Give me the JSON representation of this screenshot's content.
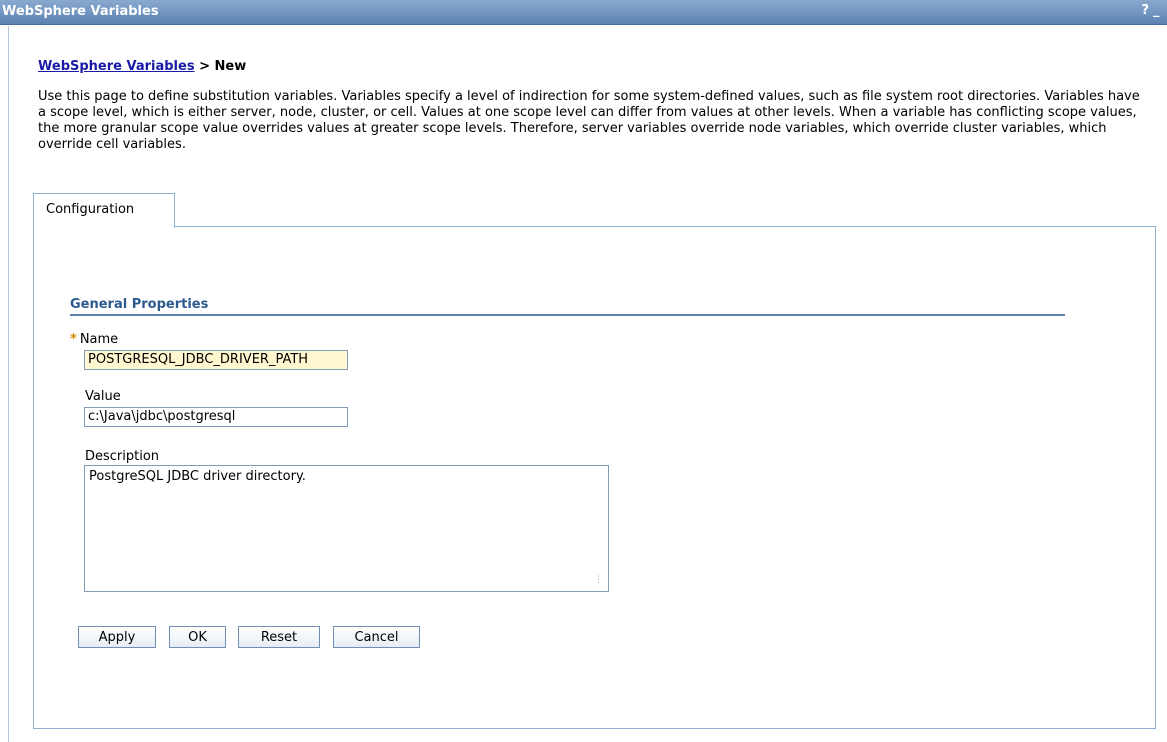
{
  "window": {
    "title": "WebSphere Variables",
    "help_label": "?",
    "minimize_label": "_"
  },
  "breadcrumb": {
    "parent_link": "WebSphere Variables",
    "separator": " > ",
    "current": "New"
  },
  "intro_text": "Use this page to define substitution variables. Variables specify a level of indirection for some system-defined values, such as file system root directories. Variables have a scope level, which is either server, node, cluster, or cell. Values at one scope level can differ from values at other levels. When a variable has conflicting scope values, the more granular scope value overrides values at greater scope levels. Therefore, server variables override node variables, which override cluster variables, which override cell variables.",
  "tabs": [
    {
      "label": "Configuration"
    }
  ],
  "general_properties": {
    "title": "General Properties",
    "name": {
      "label": "Name",
      "required_marker": "*",
      "value": "POSTGRESQL_JDBC_DRIVER_PATH"
    },
    "value": {
      "label": "Value",
      "value": "c:\\Java\\jdbc\\postgresql"
    },
    "description": {
      "label": "Description",
      "value": "PostgreSQL JDBC driver directory."
    }
  },
  "buttons": {
    "apply": "Apply",
    "ok": "OK",
    "reset": "Reset",
    "cancel": "Cancel"
  },
  "colors": {
    "titlebar": "#5b82b3",
    "link": "#1a1aa6",
    "section_title": "#2d5a8e",
    "name_field_bg": "#fff7cf",
    "required_star": "#d08a00"
  }
}
